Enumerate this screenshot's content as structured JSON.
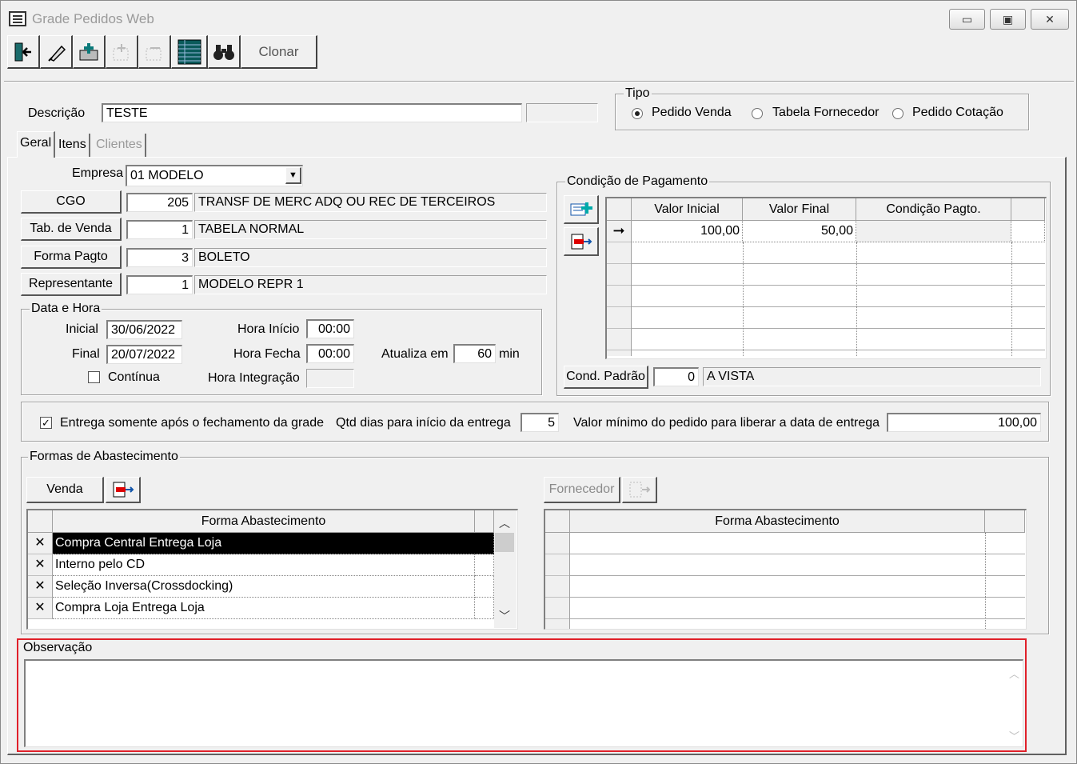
{
  "window": {
    "title": "Grade Pedidos Web",
    "controls": {
      "minimize": "▭",
      "maximize": "▣",
      "close": "✕"
    }
  },
  "toolbar": {
    "buttons": [
      "exit-icon",
      "eraser-icon",
      "add-icon",
      "insert-icon",
      "remove-icon",
      "spreadsheet-icon",
      "binoculars-icon"
    ],
    "clone_label": "Clonar"
  },
  "header": {
    "descricao_label": "Descrição",
    "descricao_value": "TESTE",
    "extra_value": ""
  },
  "tipo": {
    "legend": "Tipo",
    "options": [
      "Pedido Venda",
      "Tabela Fornecedor",
      "Pedido Cotação"
    ],
    "selected": "Pedido Venda"
  },
  "tabs": [
    "Geral",
    "Itens",
    "Clientes"
  ],
  "empresa": {
    "label": "Empresa",
    "value": "01 MODELO"
  },
  "cgo": {
    "label": "CGO",
    "code": "205",
    "desc": "TRANSF DE MERC ADQ OU REC DE TERCEIROS"
  },
  "tab_venda": {
    "label": "Tab. de Venda",
    "code": "1",
    "desc": "TABELA NORMAL"
  },
  "forma_pagto": {
    "label": "Forma Pagto",
    "code": "3",
    "desc": "BOLETO"
  },
  "representante": {
    "label": "Representante",
    "code": "1",
    "desc": "MODELO REPR 1"
  },
  "data_hora": {
    "legend": "Data e Hora",
    "inicial_label": "Inicial",
    "inicial": "30/06/2022",
    "final_label": "Final",
    "final": "20/07/2022",
    "continua_label": "Contínua",
    "hora_inicio_label": "Hora Início",
    "hora_inicio": "00:00",
    "hora_fecha_label": "Hora Fecha",
    "hora_fecha": "00:00",
    "hora_integracao_label": "Hora Integração",
    "hora_integracao": "",
    "atualiza_label": "Atualiza em",
    "atualiza": "60",
    "min_label": "min"
  },
  "cond_pagto": {
    "legend": "Condição de Pagamento",
    "columns": [
      "Valor Inicial",
      "Valor Final",
      "Condição Pagto."
    ],
    "rows": [
      [
        "100,00",
        "50,00",
        ""
      ]
    ],
    "cond_padrao_label": "Cond. Padrão",
    "cond_padrao_code": "0",
    "cond_padrao_desc": "A VISTA"
  },
  "entrega": {
    "check_label": "Entrega somente após o fechamento da grade",
    "checked": true,
    "qtd_label": "Qtd dias para início da entrega",
    "qtd": "5",
    "valor_label": "Valor mínimo do pedido para liberar a data de entrega",
    "valor": "100,00"
  },
  "abastecimento": {
    "legend": "Formas de Abastecimento",
    "venda_label": "Venda",
    "fornecedor_label": "Fornecedor",
    "column": "Forma Abastecimento",
    "items": [
      "Compra Central Entrega Loja",
      "Interno pelo CD",
      "Seleção Inversa(Crossdocking)",
      "Compra Loja Entrega Loja"
    ]
  },
  "observacao": {
    "label": "Observação",
    "value": ""
  }
}
